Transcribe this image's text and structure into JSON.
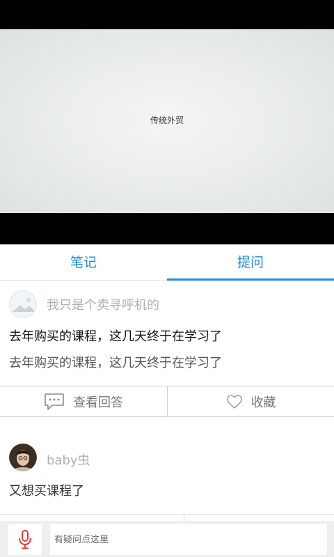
{
  "video": {
    "caption": "传统外贸"
  },
  "tabs": {
    "notes": "笔记",
    "questions": "提问"
  },
  "post1": {
    "username": "我只是个卖寻呼机的",
    "title": "去年购买的课程，这几天终于在学习了",
    "body": "去年购买的课程，这几天终于在学习了",
    "view_answers": "查看回答",
    "favorite": "收藏"
  },
  "post2": {
    "username": "baby虫",
    "title": "又想买课程了"
  },
  "input": {
    "placeholder": "有疑问点这里"
  },
  "colors": {
    "accent": "#1e88e5",
    "mic": "#e53935"
  }
}
